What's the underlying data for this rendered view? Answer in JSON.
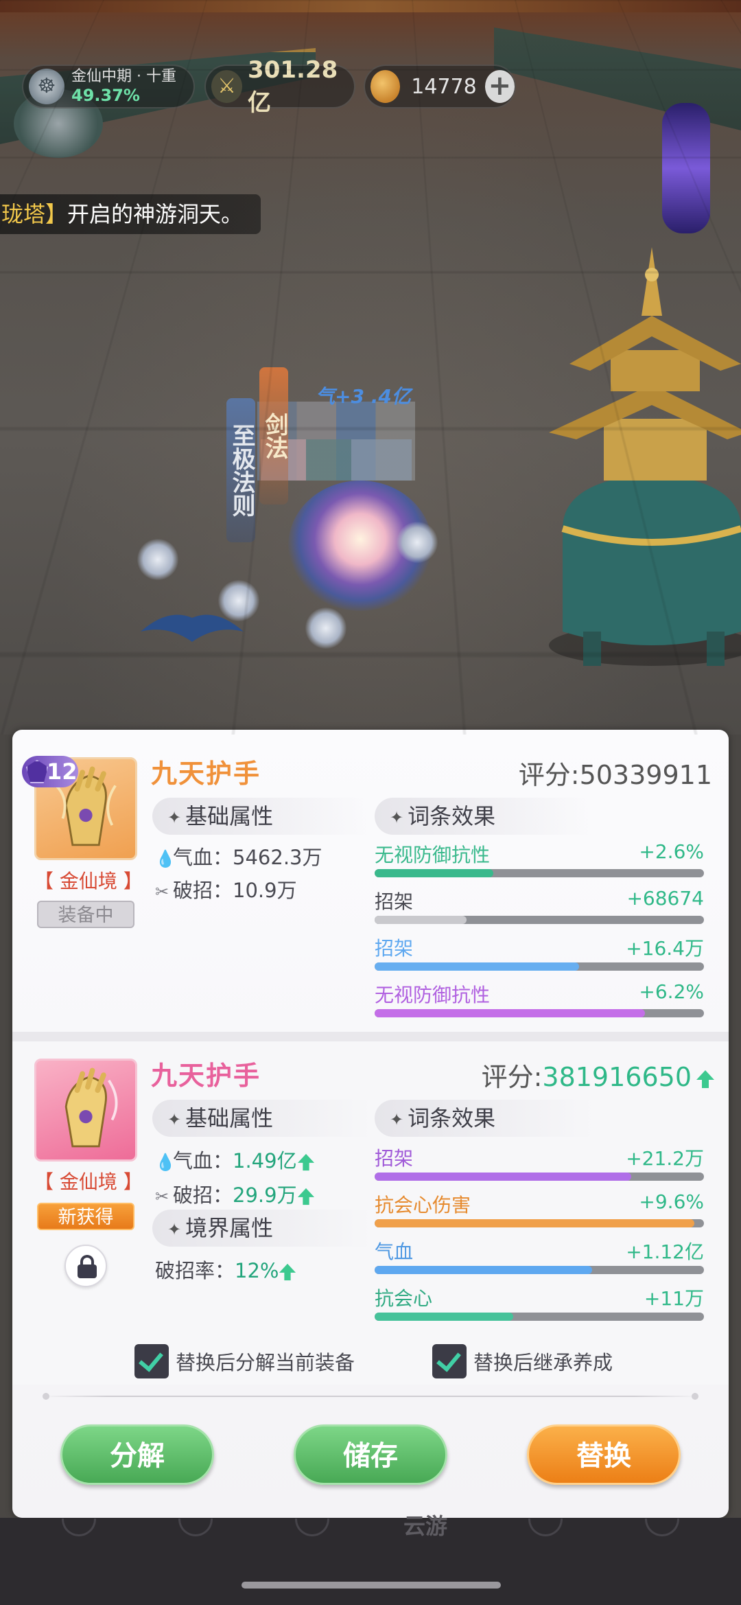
{
  "hud": {
    "realm_name": "金仙中期 · 十重",
    "realm_progress": "49.37%",
    "combat_power": "301.28亿",
    "currency_amount": "14778",
    "add_label": "+"
  },
  "notice": {
    "highlight": "珑塔】",
    "text": "开启的神游洞天。"
  },
  "scene": {
    "banner_1": "至极法则",
    "banner_2": "剑法",
    "damage_text": "气+3 .4亿"
  },
  "current_item": {
    "name": "九天护手",
    "level": "12",
    "score_label": "评分:",
    "score": "50339911",
    "realm": "【 金仙境 】",
    "status": "装备中",
    "base_header": "基础属性",
    "base_stats": [
      {
        "icon": "blood-icon",
        "label": "气血：",
        "value": "5462.3万"
      },
      {
        "icon": "break-icon",
        "label": "破招：",
        "value": "10.9万"
      }
    ],
    "affix_header": "词条效果",
    "affixes": [
      {
        "name": "无视防御抗性",
        "value": "+2.6%",
        "color": "#39b98c",
        "fill": 0.36
      },
      {
        "name": "招架",
        "value": "+68674",
        "color": "#c9c9cd",
        "fill": 0.28
      },
      {
        "name": "招架",
        "value": "+16.4万",
        "color": "#67aef0",
        "fill": 0.62
      },
      {
        "name": "无视防御抗性",
        "value": "+6.2%",
        "color": "#c46ee8",
        "fill": 0.82
      }
    ]
  },
  "new_item": {
    "name": "九天护手",
    "score_label": "评分:",
    "score": "381916650",
    "realm": "【 金仙境 】",
    "status": "新获得",
    "base_header": "基础属性",
    "base_stats": [
      {
        "icon": "blood-icon",
        "label": "气血：",
        "value": "1.49亿"
      },
      {
        "icon": "break-icon",
        "label": "破招：",
        "value": "29.9万"
      }
    ],
    "realm_header": "境界属性",
    "realm_stats": [
      {
        "label": "破招率：",
        "value": "12%"
      }
    ],
    "affix_header": "词条效果",
    "affixes": [
      {
        "name": "招架",
        "value": "+21.2万",
        "color": "#b06ee8",
        "fill": 0.78
      },
      {
        "name": "抗会心伤害",
        "value": "+9.6%",
        "color": "#f0a04a",
        "fill": 0.97
      },
      {
        "name": "气血",
        "value": "+1.12亿",
        "color": "#5ea8f0",
        "fill": 0.66
      },
      {
        "name": "抗会心",
        "value": "+11万",
        "color": "#46c29a",
        "fill": 0.42
      }
    ]
  },
  "options": {
    "decompose_current": "替换后分解当前装备",
    "inherit_growth": "替换后继承养成"
  },
  "actions": {
    "decompose": "分解",
    "store": "储存",
    "replace": "替换"
  },
  "bottom": {
    "cloud_label": "云游"
  },
  "colors": {
    "accent_green": "#2fb888",
    "orange": "#f0913a",
    "pink": "#e8619c"
  }
}
